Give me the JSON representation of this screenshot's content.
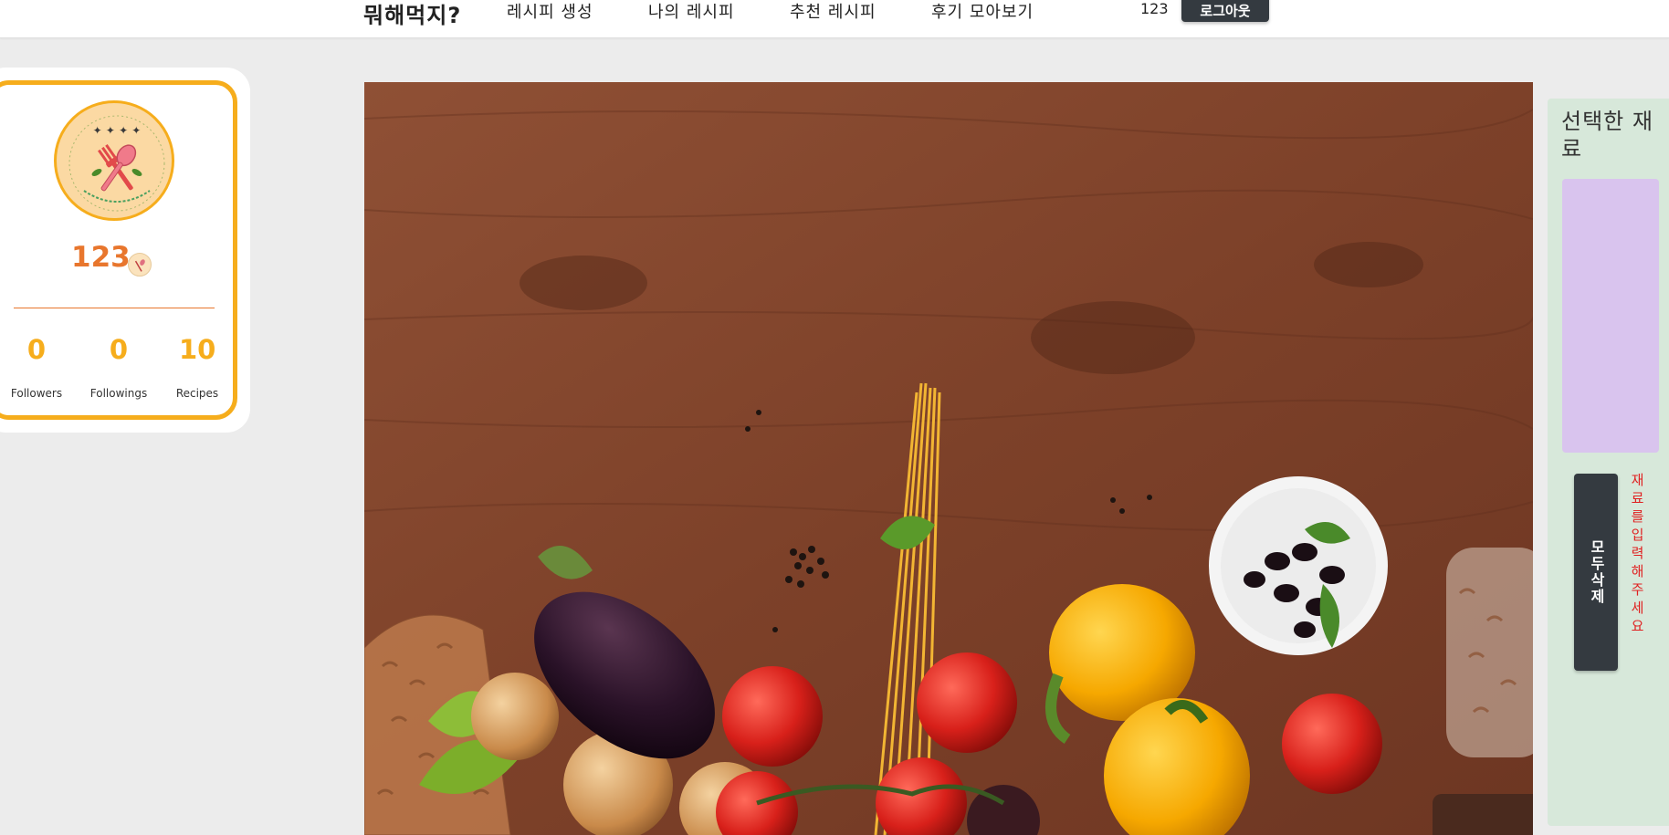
{
  "header": {
    "brand": "뭐해먹지?",
    "nav": [
      {
        "label": "레시피 생성"
      },
      {
        "label": "나의 레시피"
      },
      {
        "label": "추천 레시피"
      },
      {
        "label": "후기 모아보기"
      }
    ],
    "username": "123",
    "logout_label": "로그아웃"
  },
  "profile": {
    "username": "123",
    "avatar_icon": "fork-spoon-logo-icon",
    "stats": [
      {
        "value": "0",
        "label": "Followers"
      },
      {
        "value": "0",
        "label": "Followings"
      },
      {
        "value": "10",
        "label": "Recipes"
      }
    ]
  },
  "ingredients": {
    "title": "선택한 재료",
    "clear_label": "모두삭제",
    "hint": "재료를입력해주세요"
  },
  "colors": {
    "accent_orange": "#e8762d",
    "accent_yellow": "#f6ad1c",
    "button_dark": "#343a40",
    "panel_green": "#d7e8da",
    "panel_purple": "#d9c4ee",
    "hint_red": "#e02020"
  }
}
